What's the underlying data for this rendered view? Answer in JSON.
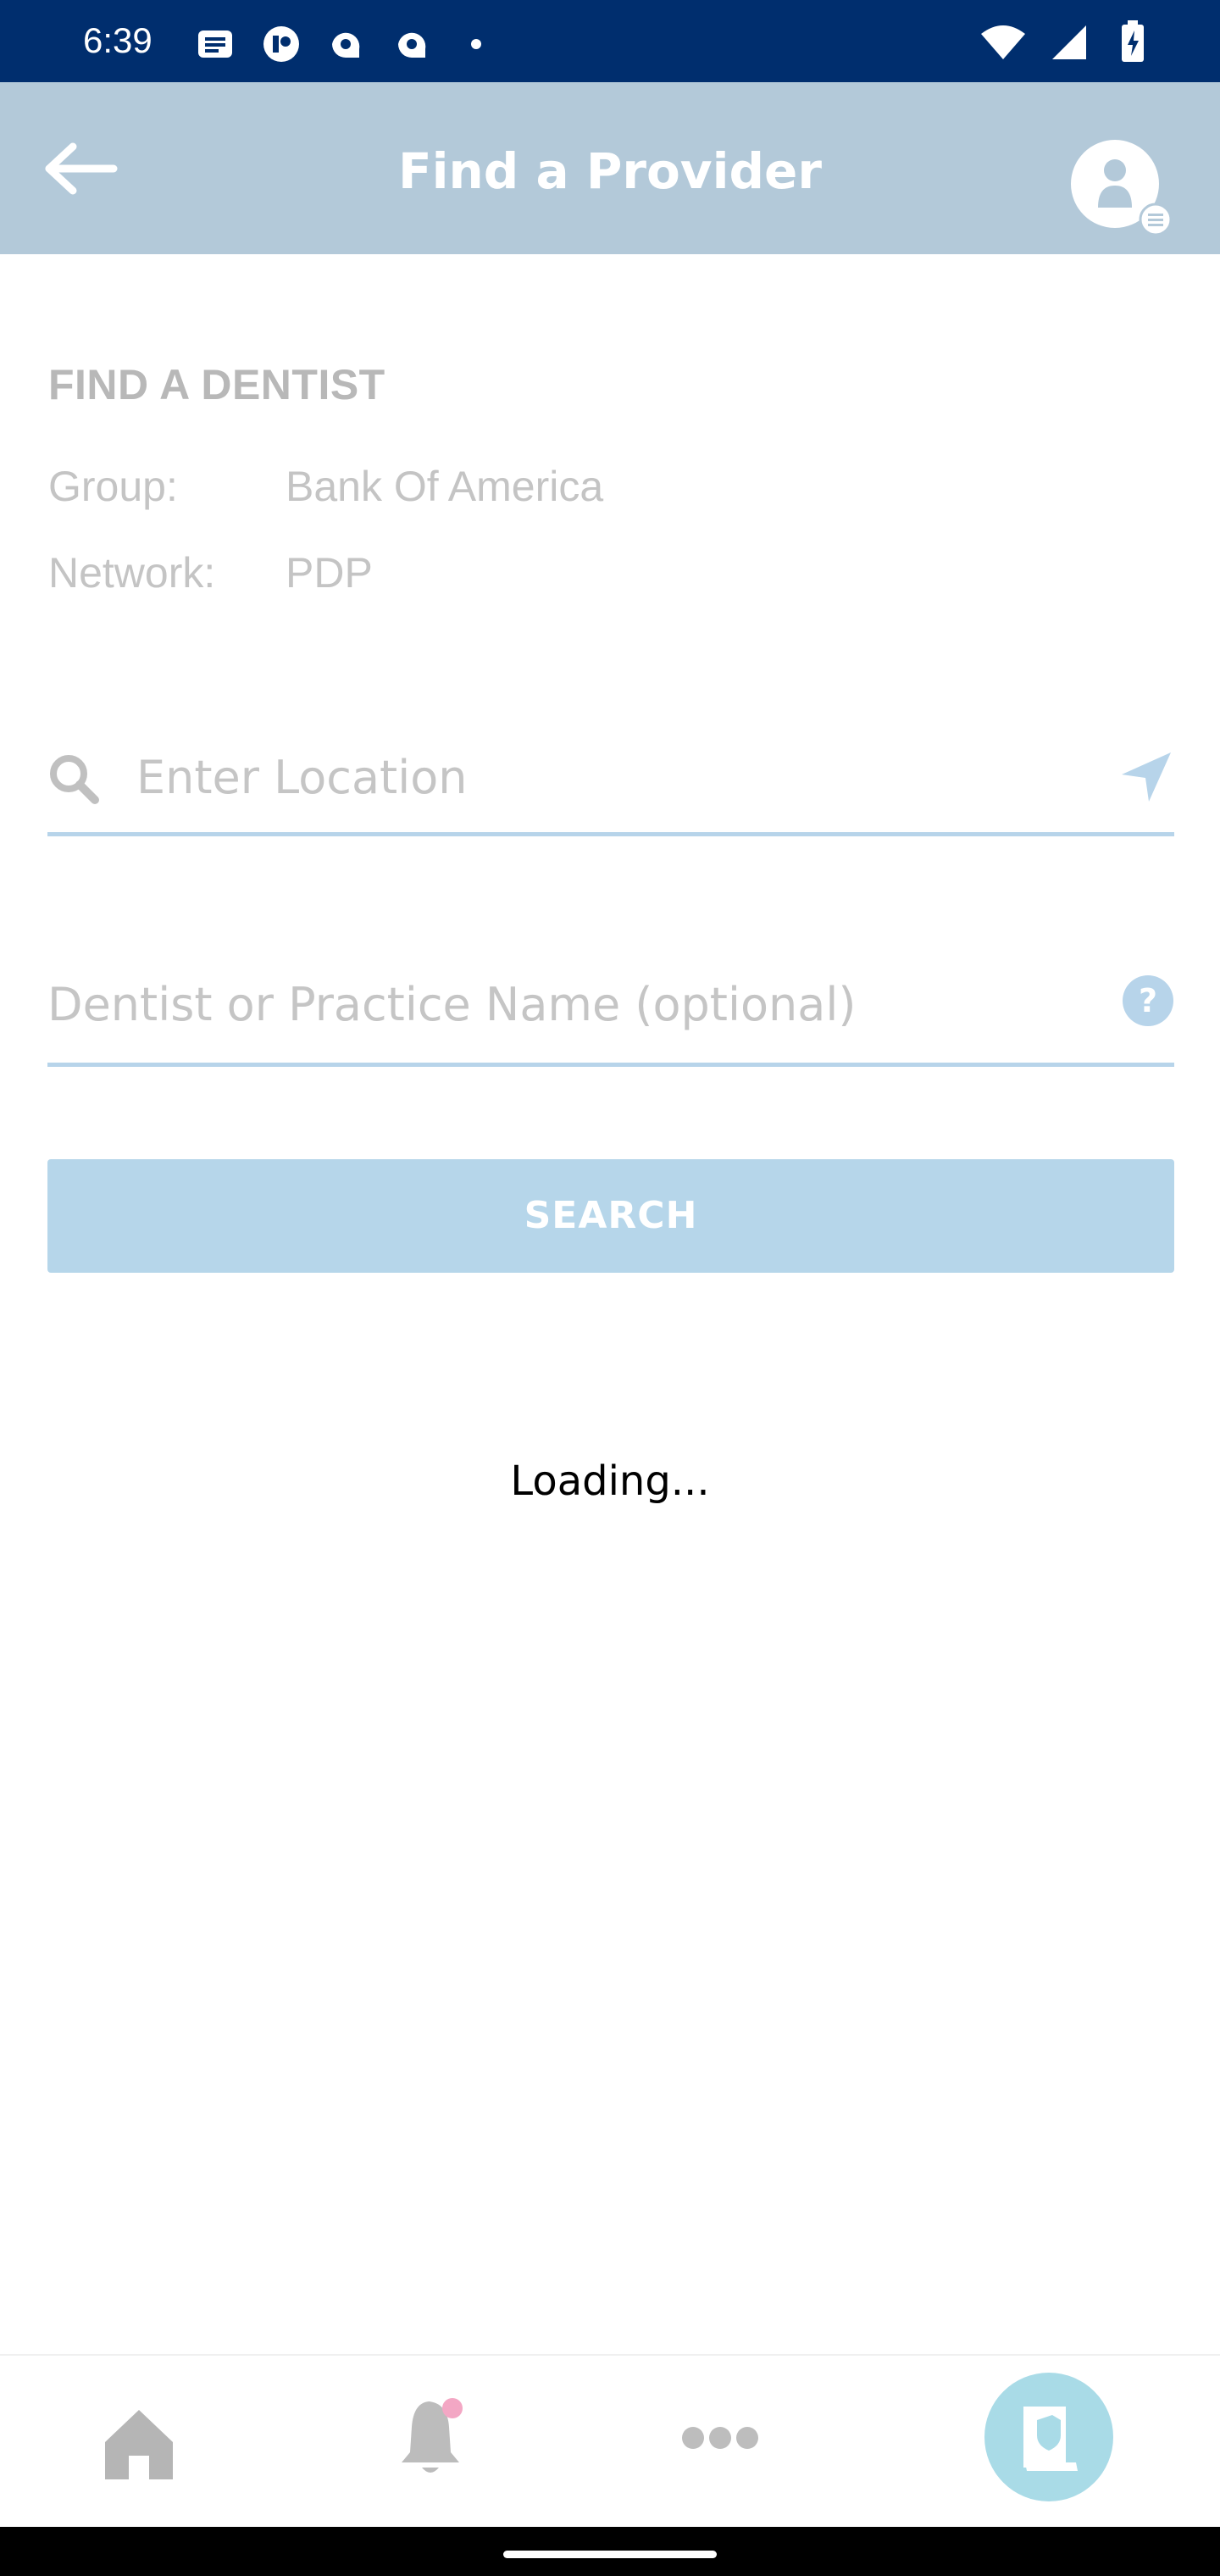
{
  "status_bar": {
    "time": "6:39"
  },
  "header": {
    "title": "Find a Provider"
  },
  "find_dentist": {
    "heading": "FIND A DENTIST",
    "group_label": "Group:",
    "group_value": "Bank Of America",
    "network_label": "Network:",
    "network_value": "PDP"
  },
  "location_input": {
    "placeholder": "Enter Location"
  },
  "name_input": {
    "placeholder": "Dentist or Practice Name (optional)"
  },
  "search_button": {
    "label": "SEARCH"
  },
  "loading": {
    "text": "Loading..."
  },
  "bottom_nav": {
    "items": [
      "home-icon",
      "bell-icon",
      "more-icon",
      "id-card-icon"
    ],
    "active": "id-card-icon"
  },
  "colors": {
    "status_bar": "#002e6e",
    "header": "#b3c9d9",
    "accent": "#b6d6ea",
    "notification_dot": "#f3a7c4",
    "active_nav_bg": "#a9dbe7"
  }
}
